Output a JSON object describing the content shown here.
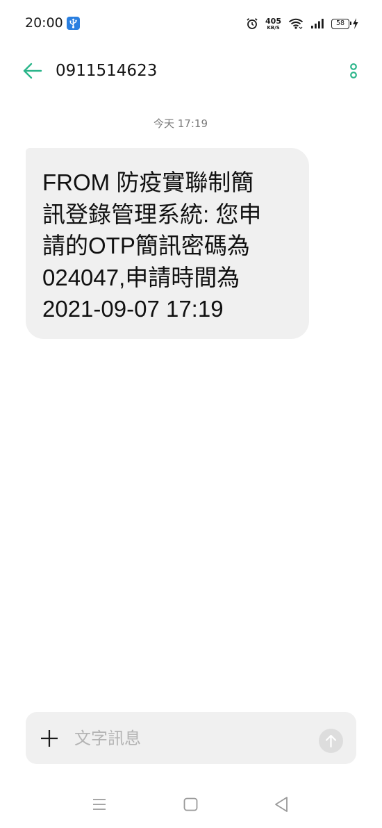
{
  "status_bar": {
    "time": "20:00",
    "network_speed_value": "405",
    "network_speed_unit": "KB/S",
    "battery_level": "58",
    "icons": [
      "usb-icon",
      "alarm-clock-icon",
      "wifi-icon",
      "cellular-signal-icon",
      "battery-icon",
      "charging-bolt-icon"
    ]
  },
  "header": {
    "contact_number": "0911514623",
    "icons": [
      "back-arrow-icon",
      "more-options-icon"
    ]
  },
  "conversation": {
    "timestamp": "今天 17:19",
    "messages": [
      {
        "direction": "incoming",
        "text": "FROM 防疫實聯制簡\n訊登錄管理系統: 您申\n請的OTP簡訊密碼為\n024047,申請時間為\n2021-09-07 17:19"
      }
    ]
  },
  "composer": {
    "placeholder": "文字訊息",
    "value": "",
    "icons": [
      "plus-icon",
      "send-arrow-icon"
    ]
  },
  "nav_bar": {
    "icons": [
      "menu-icon",
      "home-square-icon",
      "back-triangle-icon"
    ]
  },
  "colors": {
    "accent": "#2bb58a",
    "bubble_background": "#f0f0f0",
    "composer_background": "#f0f0f0",
    "timestamp_text": "#7a7a7a",
    "placeholder_text": "#b4b4b4",
    "usb_badge": "#2a7fe0"
  }
}
